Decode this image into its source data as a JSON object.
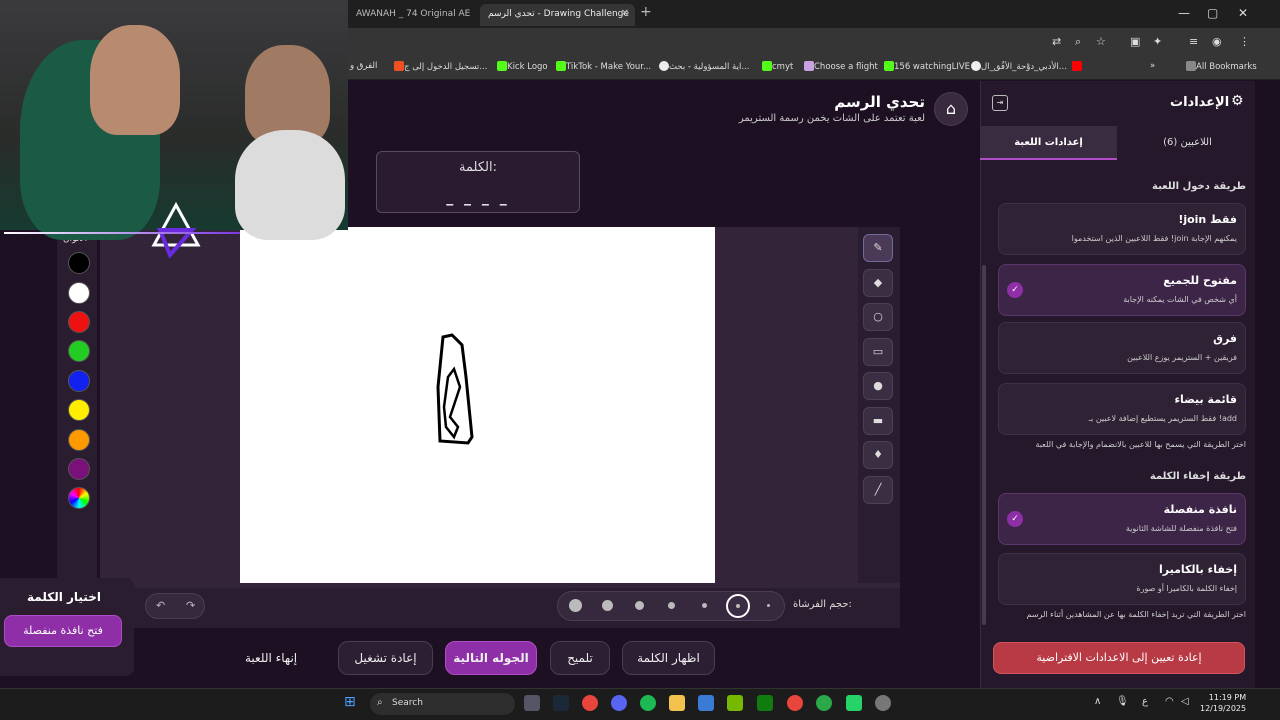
{
  "browser": {
    "tabs": [
      {
        "label": "AWANAH _ 74 Original AE اوناه"
      },
      {
        "label": "تحدي الرسم - Drawing Challenge"
      }
    ],
    "bookmarks": [
      "الفرق و",
      "تسجيل الدخول إلى ج...",
      "Kick Logo",
      "TikTok - Make Your...",
      "اية المسؤولية - بحث...",
      "cmyt",
      "Choose a flight",
      "156 watchingLIVE",
      "الأدبي_دوْحة_الأفُق_ال...",
      "All Bookmarks"
    ]
  },
  "header": {
    "title": "تحدي الرسم",
    "subtitle": "لعبة تعتمد على الشات يخمن رسمة الستريمر"
  },
  "word": {
    "label": "الكلمة:",
    "blanks": "_ _ _ _"
  },
  "colors": {
    "label": "الألوان",
    "swatches": [
      "#000000",
      "#ffffff",
      "#ee1111",
      "#22cc22",
      "#1122ee",
      "#ffee00",
      "#ff9900",
      "#7a117a"
    ]
  },
  "brush": {
    "label": "حجم الفرشاة:",
    "undo": "↶",
    "redo": "↷"
  },
  "actions": {
    "show_word": "اظهار الكلمة",
    "hint": "تلميح",
    "next_round": "الجوله التالية",
    "restart": "إعادة تشغيل",
    "end_game": "إنهاء اللعبة"
  },
  "choose_word": {
    "title": "اختيار الكلمة",
    "button": "فتح نافذة منفصلة"
  },
  "settings": {
    "title": "الإعدادات",
    "tabs": {
      "players": "اللاعبين (6)",
      "game": "إعدادات اللعبة"
    },
    "join_section": "طريقة دخول اللعبة",
    "join_options": [
      {
        "title": "!join فقط",
        "desc": "فقط اللاعبين الذين استخدموا !join يمكنهم الإجابة"
      },
      {
        "title": "مفتوح للجميع",
        "desc": "أي شخص في الشات يمكنه الإجابة"
      },
      {
        "title": "فرق",
        "desc": "فريقين + الستريمر يوزع اللاعبين"
      },
      {
        "title": "قائمة بيضاء",
        "desc": "فقط الستريمر يستطيع إضافة لاعبين بـ !add"
      }
    ],
    "join_note": "اختر الطريقة التي يسمح بها للاعبين بالانضمام والإجابة في اللعبة",
    "hide_section": "طريقة إخفاء الكلمة",
    "hide_options": [
      {
        "title": "نافذة منفصلة",
        "desc": "فتح نافذة منفصلة للشاشة الثانوية"
      },
      {
        "title": "إخفاء بالكاميرا",
        "desc": "إخفاء الكلمة بالكاميرا أو صورة"
      }
    ],
    "hide_note": "اختر الطريقة التي تريد إخفاء الكلمة بها عن المشاهدين أثناء الرسم",
    "reset": "إعادة تعيين إلى الاعدادات الافتراضية"
  },
  "taskbar": {
    "search": "Search",
    "lang": "ع",
    "time": "11:19 PM",
    "date": "12/19/2025"
  }
}
